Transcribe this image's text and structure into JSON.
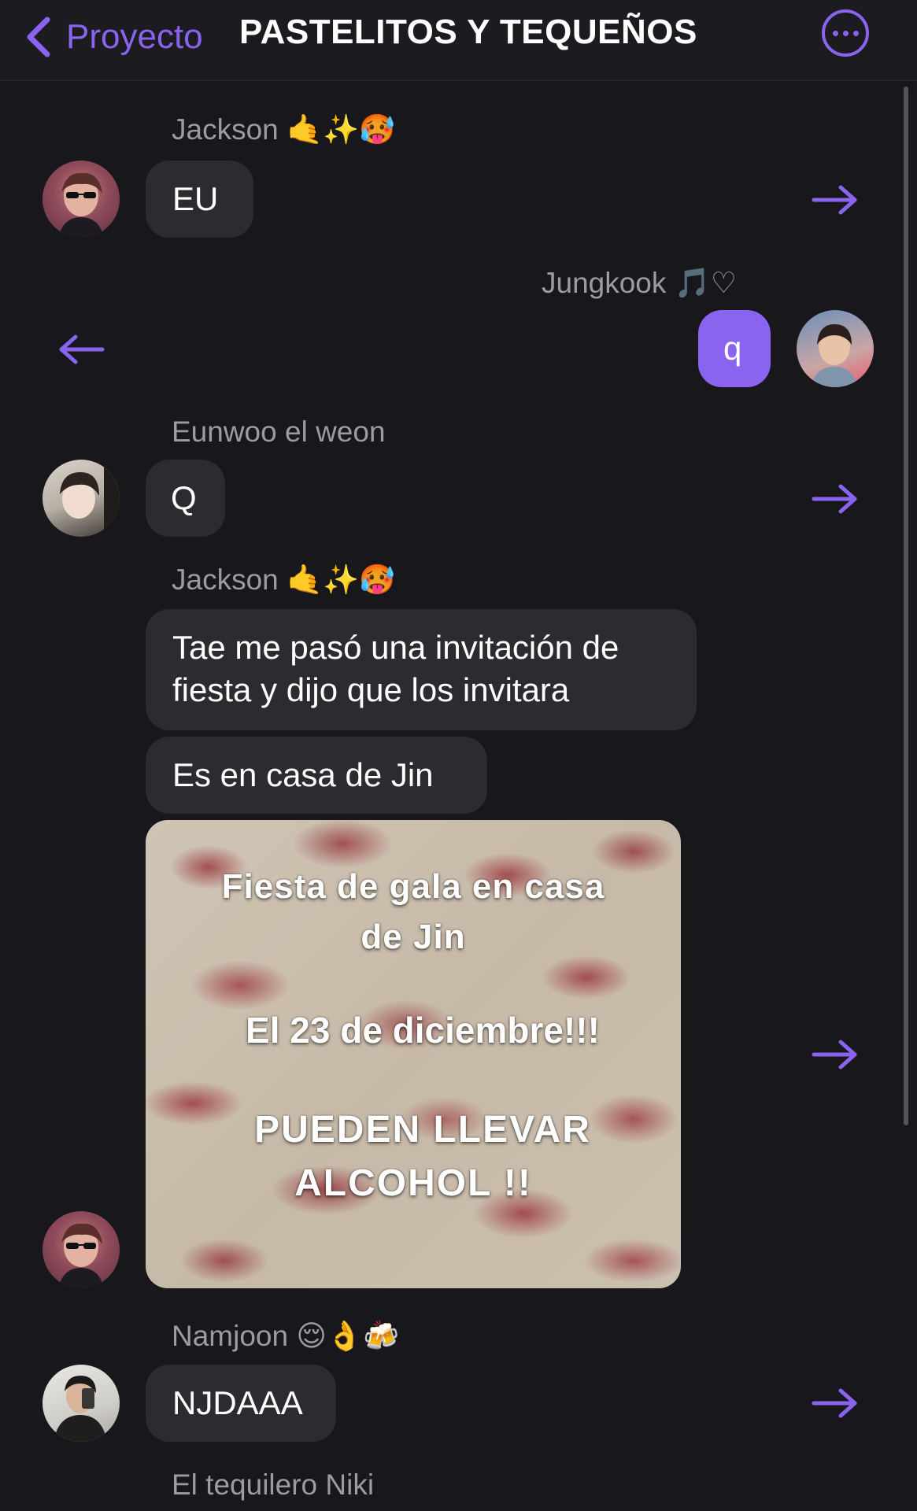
{
  "header": {
    "back_label": "Proyecto",
    "title": "PASTELITOS Y TEQUEÑOS"
  },
  "messages": [
    {
      "sender": "Jackson 🤙✨🥵",
      "text": "EU",
      "direction": "incoming"
    },
    {
      "sender": "Jungkook 🎵♡",
      "text": "q",
      "direction": "outgoing"
    },
    {
      "sender": "Eunwoo el weon",
      "text": "Q",
      "direction": "incoming"
    },
    {
      "sender": "Jackson 🤙✨🥵",
      "texts": [
        "Tae me pasó una invitación de",
        "fiesta y dijo que los invitara",
        "Es en casa de Jin"
      ],
      "image": {
        "line1": "Fiesta de gala en casa",
        "line2": "de Jin",
        "line3": "El 23 de diciembre!!!",
        "line4": "PUEDEN LLEVAR",
        "line5": "ALCOHOL !!"
      },
      "direction": "incoming"
    },
    {
      "sender": "Namjoon 😌👌🍻",
      "text": "NJDAAA",
      "direction": "incoming"
    },
    {
      "sender": "El tequilero Niki",
      "direction": "incoming"
    }
  ],
  "colors": {
    "accent": "#8a63ee",
    "background": "#18171b",
    "bubble": "#2c2b30"
  }
}
